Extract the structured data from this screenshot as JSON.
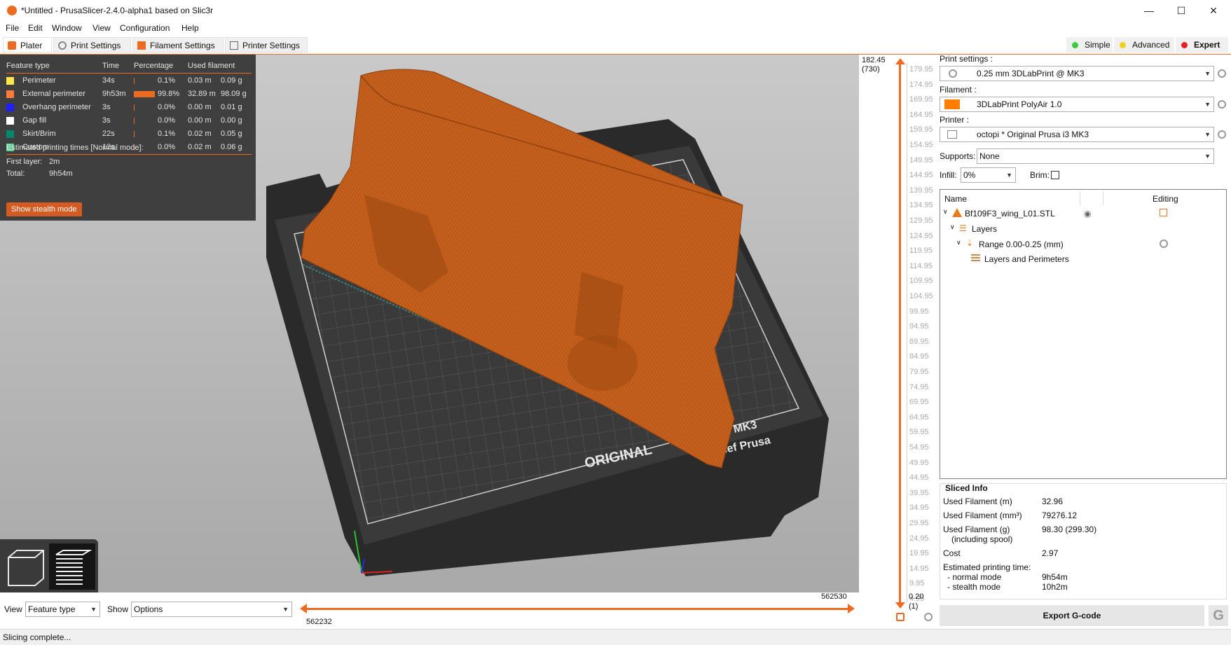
{
  "window": {
    "title": "*Untitled - PrusaSlicer-2.4.0-alpha1 based on Slic3r",
    "controls": {
      "minimize": "—",
      "maximize": "☐",
      "close": "✕"
    }
  },
  "menu": [
    "File",
    "Edit",
    "Window",
    "View",
    "Configuration",
    "Help"
  ],
  "tabs": [
    "Plater",
    "Print Settings",
    "Filament Settings",
    "Printer Settings"
  ],
  "modes": [
    {
      "label": "Simple",
      "color": "#3ccb3c"
    },
    {
      "label": "Advanced",
      "color": "#f2d11a"
    },
    {
      "label": "Expert",
      "color": "#e82020"
    }
  ],
  "legend": {
    "headers": [
      "Feature type",
      "Time",
      "Percentage",
      "Used filament"
    ],
    "rows": [
      {
        "name": "Perimeter",
        "color": "#ffe64d",
        "time": "34s",
        "pct": "0.1%",
        "pct_value": 0.1,
        "len": "0.03 m",
        "g": "0.09 g"
      },
      {
        "name": "External perimeter",
        "color": "#ff7d38",
        "time": "9h53m",
        "pct": "99.8%",
        "pct_value": 99.8,
        "len": "32.89 m",
        "g": "98.09 g"
      },
      {
        "name": "Overhang perimeter",
        "color": "#1f1fff",
        "time": "3s",
        "pct": "0.0%",
        "pct_value": 0.0,
        "len": "0.00 m",
        "g": "0.01 g"
      },
      {
        "name": "Gap fill",
        "color": "#ffffff",
        "time": "3s",
        "pct": "0.0%",
        "pct_value": 0.0,
        "len": "0.00 m",
        "g": "0.00 g"
      },
      {
        "name": "Skirt/Brim",
        "color": "#00876e",
        "time": "22s",
        "pct": "0.1%",
        "pct_value": 0.1,
        "len": "0.02 m",
        "g": "0.05 g"
      },
      {
        "name": "Custom",
        "color": "#5ed194",
        "time": "12s",
        "pct": "0.0%",
        "pct_value": 0.0,
        "len": "0.02 m",
        "g": "0.06 g"
      }
    ],
    "estimated_title": "Estimated printing times [Normal mode]:",
    "first_layer_label": "First layer:",
    "first_layer_value": "2m",
    "total_label": "Total:",
    "total_value": "9h54m",
    "stealth_button": "Show stealth mode"
  },
  "bed_text": {
    "line1": "ORIGINAL",
    "line2": "MK3",
    "line3": "sef Prusa"
  },
  "bottom": {
    "view_label": "View",
    "view_value": "Feature type",
    "show_label": "Show",
    "show_value": "Options",
    "hslider_left": "562232",
    "hslider_right": "562530"
  },
  "vslider": {
    "top_value": "182.45",
    "top_layer": "(730)",
    "bottom_value": "0.20",
    "bottom_layer": "(1)",
    "ticks": [
      "179.95",
      "174.95",
      "169.95",
      "164.95",
      "159.95",
      "154.95",
      "149.95",
      "144.95",
      "139.95",
      "134.95",
      "129.95",
      "124.95",
      "119.95",
      "114.95",
      "109.95",
      "104.95",
      "99.95",
      "94.95",
      "89.95",
      "84.95",
      "79.95",
      "74.95",
      "69.95",
      "64.95",
      "59.95",
      "54.95",
      "49.95",
      "44.95",
      "39.95",
      "34.95",
      "29.95",
      "24.95",
      "19.95",
      "14.95",
      "9.95",
      "4.95"
    ]
  },
  "right": {
    "print_settings_label": "Print settings :",
    "print_settings_value": "0.25 mm 3DLabPrint @ MK3",
    "filament_label": "Filament :",
    "filament_value": "3DLabPrint PolyAir 1.0",
    "filament_color": "#ff7d00",
    "printer_label": "Printer :",
    "printer_value": "octopi * Original Prusa i3 MK3",
    "supports_label": "Supports:",
    "supports_value": "None",
    "infill_label": "Infill:",
    "infill_value": "0%",
    "brim_label": "Brim:",
    "list_headers": {
      "name": "Name",
      "editing": "Editing"
    },
    "tree": {
      "object": "Bf109F3_wing_L01.STL",
      "layers": "Layers",
      "range": "Range 0.00-0.25 (mm)",
      "sub": "Layers and Perimeters"
    },
    "sliced": {
      "title": "Sliced Info",
      "used_m_label": "Used Filament (m)",
      "used_m": "32.96",
      "used_mm3_label": "Used Filament (mm³)",
      "used_mm3": "79276.12",
      "used_g_label": "Used Filament (g)",
      "used_g_sub": "(including spool)",
      "used_g": "98.30 (299.30)",
      "cost_label": "Cost",
      "cost": "2.97",
      "est_label": "Estimated printing time:",
      "normal_label": "- normal mode",
      "normal": "9h54m",
      "stealth_label": "- stealth mode",
      "stealth": "10h2m"
    },
    "export_button": "Export G-code"
  },
  "status": "Slicing complete..."
}
